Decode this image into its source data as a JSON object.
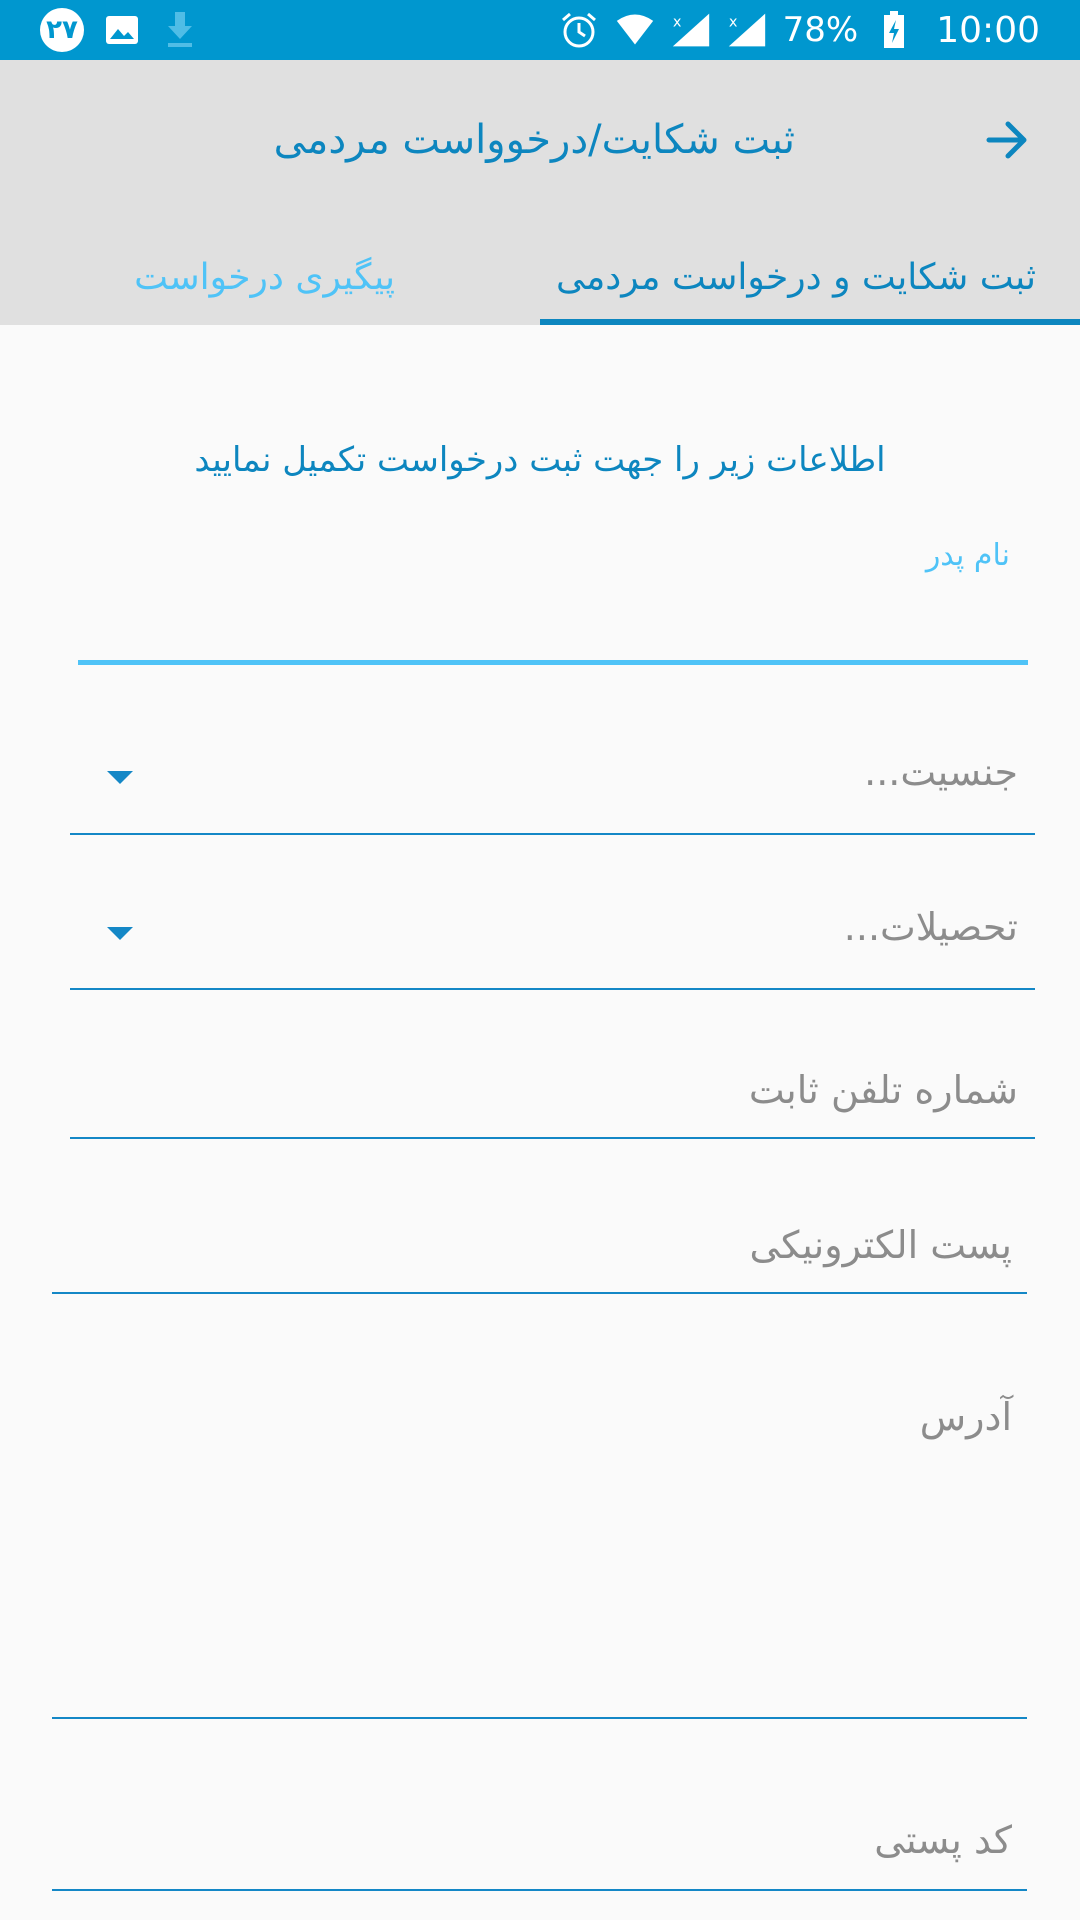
{
  "status_bar": {
    "notification_count": "۲۷",
    "battery": "78%",
    "time": "10:00"
  },
  "app_bar": {
    "title": "ثبت شکایت/درخوواست مردمی",
    "back_icon": "arrow-right-icon"
  },
  "tabs": [
    {
      "label": "ثبت شکایت و درخواست مردمی",
      "active": true
    },
    {
      "label": "پیگیری درخواست",
      "active": false
    }
  ],
  "form": {
    "header": "اطلاعات زیر را جهت ثبت درخواست تکمیل نمایید",
    "father_name_label": "نام پدر",
    "gender_placeholder": "جنسیت...",
    "education_placeholder": "تحصیلات...",
    "phone_placeholder": "شماره تلفن ثابت",
    "email_placeholder": "پست الکترونیکی",
    "address_placeholder": "آدرس",
    "postal_code_placeholder": "کد پستی"
  },
  "colors": {
    "status_bar": "#0097cf",
    "app_bar": "#e0e0e0",
    "accent": "#0d86bf",
    "accent_light": "#4fc3f7",
    "background": "#fafafa"
  }
}
